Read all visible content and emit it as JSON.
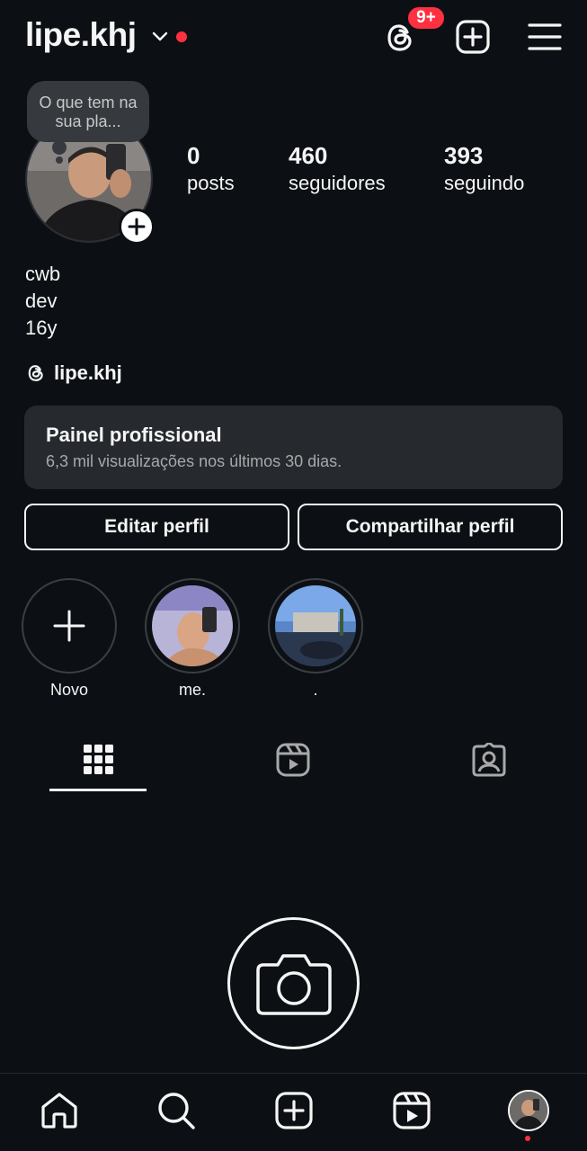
{
  "header": {
    "username": "lipe.khj",
    "threads_badge": "9+",
    "accent_color": "#ff3040"
  },
  "profile": {
    "note": "O que tem na sua pla...",
    "stats": [
      {
        "value": "0",
        "label": "posts"
      },
      {
        "value": "460",
        "label": "seguidores"
      },
      {
        "value": "393",
        "label": "seguindo"
      }
    ],
    "bio": [
      "cwb",
      "dev",
      "16y"
    ],
    "threads_handle": "lipe.khj"
  },
  "panel": {
    "title": "Painel profissional",
    "subtitle": "6,3 mil visualizações nos últimos 30 dias."
  },
  "actions": {
    "edit": "Editar perfil",
    "share": "Compartilhar perfil"
  },
  "highlights": [
    {
      "label": "Novo"
    },
    {
      "label": "me."
    },
    {
      "label": "."
    }
  ],
  "tabs": [
    "grid-icon",
    "reels-icon",
    "tagged-icon"
  ],
  "bottom_nav": [
    "home-icon",
    "search-icon",
    "create-icon",
    "reels-icon",
    "profile-avatar"
  ]
}
